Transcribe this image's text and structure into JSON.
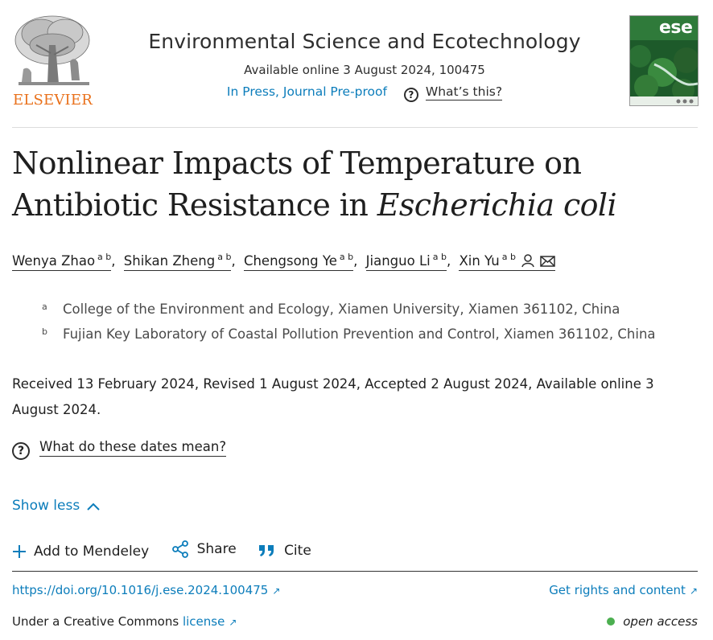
{
  "header": {
    "publisher": "ELSEVIER",
    "journal_title": "Environmental Science and Ecotechnology",
    "available": "Available online 3 August 2024, 100475",
    "status_link": "In Press, Journal Pre-proof",
    "whats_this": "What’s this?",
    "cover_label": "ese"
  },
  "article": {
    "title_plain": "Nonlinear Impacts of Temperature on Antibiotic Resistance in ",
    "title_italic": "Escherichia coli",
    "authors": [
      {
        "name": "Wenya Zhao",
        "sup": "a b"
      },
      {
        "name": "Shikan Zheng",
        "sup": "a b"
      },
      {
        "name": "Chengsong Ye",
        "sup": "a b"
      },
      {
        "name": "Jianguo Li",
        "sup": "a b"
      },
      {
        "name": "Xin Yu",
        "sup": "a b"
      }
    ],
    "affiliations": [
      {
        "label": "a",
        "text": "College of the Environment and Ecology, Xiamen University, Xiamen 361102, China"
      },
      {
        "label": "b",
        "text": "Fujian Key Laboratory of Coastal Pollution Prevention and Control, Xiamen 361102, China"
      }
    ],
    "dates": "Received 13 February 2024, Revised 1 August 2024, Accepted 2 August 2024, Available online 3 August 2024.",
    "dates_help": "What do these dates mean?",
    "show_less": "Show less"
  },
  "actions": {
    "mendeley": "Add to Mendeley",
    "share": "Share",
    "cite": "Cite"
  },
  "footer": {
    "doi": "https://doi.org/10.1016/j.ese.2024.100475",
    "rights": "Get rights and content",
    "license_prefix": "Under a Creative Commons ",
    "license_link": "license",
    "open_access": "open access"
  },
  "colors": {
    "link": "#0c7dbb",
    "elsevier_orange": "#e9711c",
    "open_access_dot": "#4caf50"
  }
}
